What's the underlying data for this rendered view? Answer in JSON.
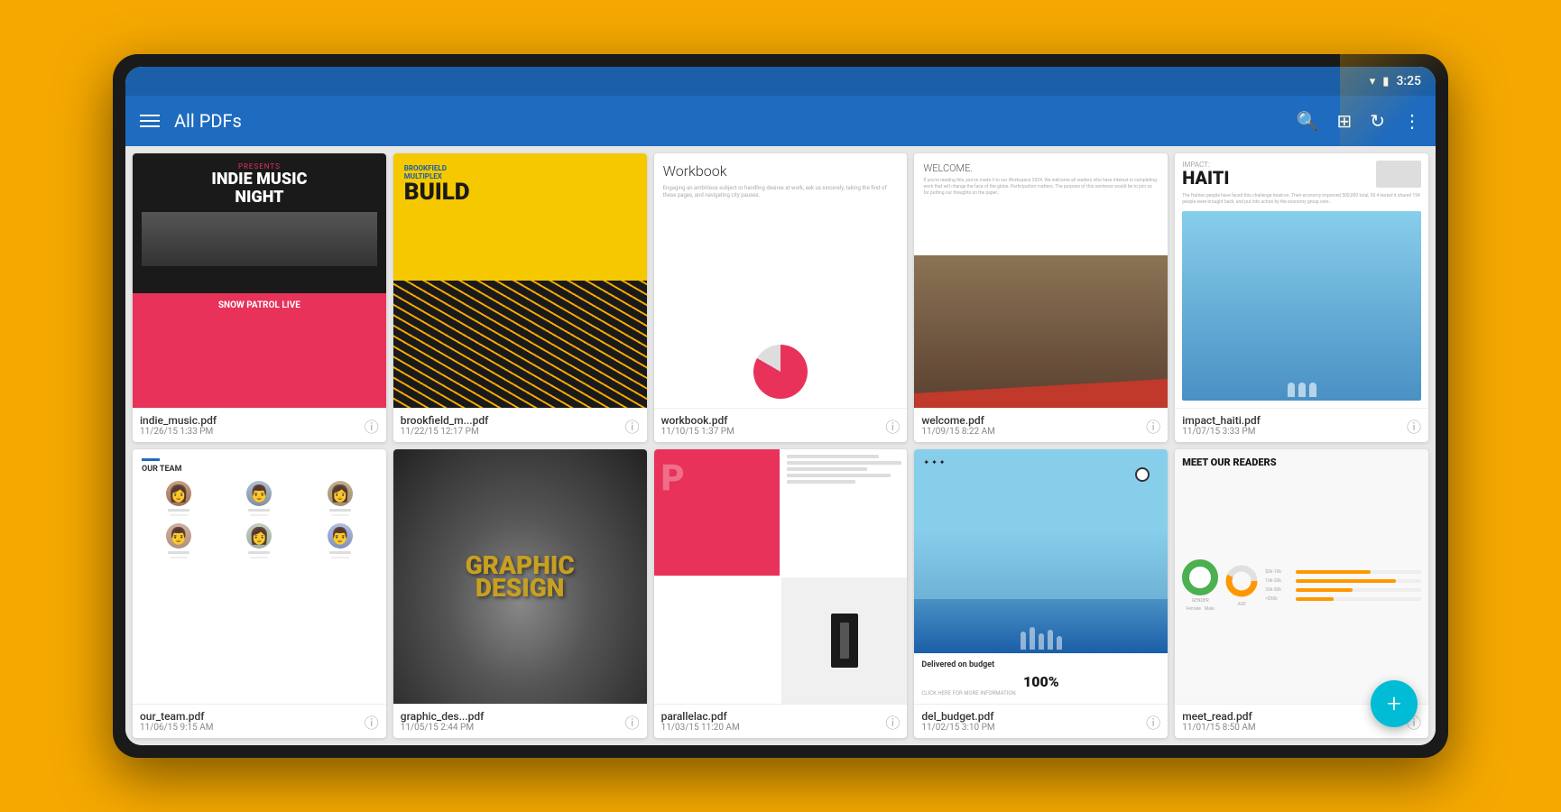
{
  "statusBar": {
    "time": "3:25",
    "wifi": "wifi",
    "battery": "battery"
  },
  "toolbar": {
    "title": "All PDFs",
    "menuIcon": "menu",
    "searchIcon": "search",
    "viewIcon": "grid",
    "syncIcon": "sync",
    "moreIcon": "more"
  },
  "pdfs": {
    "row1": [
      {
        "id": "indie_music",
        "name": "indie_music.pdf",
        "date": "11/26/15 1:33 PM",
        "theme": "indie"
      },
      {
        "id": "brookfield",
        "name": "brookfield_m...pdf",
        "date": "11/22/15 12:17 PM",
        "theme": "brookfield"
      },
      {
        "id": "workbook",
        "name": "workbook.pdf",
        "date": "11/10/15 1:37 PM",
        "theme": "workbook"
      },
      {
        "id": "welcome",
        "name": "welcome.pdf",
        "date": "11/09/15 8:22 AM",
        "theme": "welcome"
      },
      {
        "id": "impact_haiti",
        "name": "impact_haiti.pdf",
        "date": "11/07/15 3:33 PM",
        "theme": "haiti"
      }
    ],
    "row2": [
      {
        "id": "our_team",
        "name": "our_team.pdf",
        "date": "11/06/15 9:15 AM",
        "theme": "ourteam"
      },
      {
        "id": "graphic_design",
        "name": "graphic_des...pdf",
        "date": "11/05/15 2:44 PM",
        "theme": "graphic"
      },
      {
        "id": "parallelac",
        "name": "parallelac.pdf",
        "date": "11/03/15 11:20 AM",
        "theme": "magazine"
      },
      {
        "id": "del_budget",
        "name": "del_budget.pdf",
        "date": "11/02/15 3:10 PM",
        "theme": "budget"
      },
      {
        "id": "meet_read",
        "name": "meet_read.pdf",
        "date": "11/01/15 8:50 AM",
        "theme": "meetread"
      }
    ]
  },
  "fab": {
    "label": "+"
  }
}
